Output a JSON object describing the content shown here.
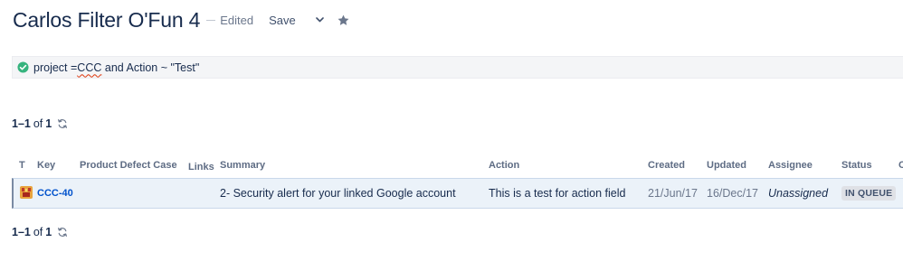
{
  "header": {
    "title": "Carlos Filter O'Fun 4",
    "edited_label": "Edited",
    "save_label": "Save"
  },
  "jql": {
    "query_prefix": "project =",
    "query_project": "CCC",
    "query_suffix": " and Action ~ \"Test\""
  },
  "pagination_top": {
    "range": "1–1",
    "of": "of",
    "total": "1"
  },
  "pagination_bottom": {
    "range": "1–1",
    "of": "of",
    "total": "1"
  },
  "table": {
    "columns": {
      "type": "T",
      "key": "Key",
      "product_defect_case": "Product Defect Case",
      "links": "Links",
      "summary": "Summary",
      "action": "Action",
      "created": "Created",
      "updated": "Updated",
      "assignee": "Assignee",
      "status": "Status",
      "extra": "C"
    },
    "rows": [
      {
        "key": "CCC-40",
        "product_defect_case": "",
        "links": "",
        "summary": "2- Security alert for your linked Google account",
        "action": "This is a test for action field",
        "created": "21/Jun/17",
        "updated": "16/Dec/17",
        "assignee": "Unassigned",
        "status": "IN QUEUE"
      }
    ]
  },
  "icons": {
    "chevron": "chevron-down-icon",
    "star": "star-icon",
    "valid": "check-circle-icon",
    "refresh": "refresh-icon",
    "issue_type": "bug-issue-type-icon"
  },
  "colors": {
    "title": "#172b4d",
    "link": "#0052cc",
    "valid_green": "#36b37e",
    "row_highlight": "#ebf2f9",
    "status_lozenge_bg": "#dfe1e6"
  }
}
